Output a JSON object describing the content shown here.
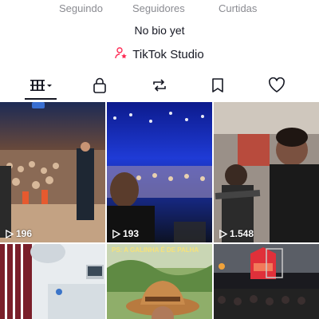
{
  "profile": {
    "stats": [
      {
        "label": "Seguindo"
      },
      {
        "label": "Seguidores"
      },
      {
        "label": "Curtidas"
      }
    ],
    "bio": "No bio yet",
    "studio_label": "TikTok Studio"
  },
  "tabs": [
    {
      "name": "videos",
      "icon": "grid-icon",
      "active": true
    },
    {
      "name": "private",
      "icon": "lock-icon"
    },
    {
      "name": "reposts",
      "icon": "repost-icon"
    },
    {
      "name": "saved",
      "icon": "bookmark-icon"
    },
    {
      "name": "liked",
      "icon": "heart-icon"
    }
  ],
  "videos": [
    {
      "views": "196"
    },
    {
      "views": "193"
    },
    {
      "views": "1.548"
    },
    {
      "views": ""
    },
    {
      "caption": "PS: A GALINHA É DE PALHA"
    },
    {
      "views": ""
    }
  ],
  "colors": {
    "accent": "#fe2c55",
    "text": "#161823",
    "muted": "#8a8b91"
  }
}
